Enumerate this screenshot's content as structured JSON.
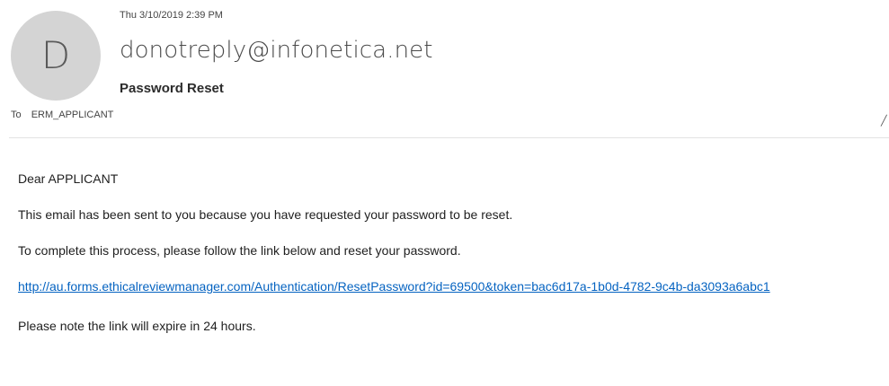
{
  "header": {
    "avatar_letter": "D",
    "sent_date": "Thu 3/10/2019 2:39 PM",
    "sender": "donotreply@infonetica.net",
    "subject": "Password Reset",
    "to_label": "To",
    "to_recipient": "ERM_APPLICANT",
    "expand_glyph": "╱"
  },
  "body": {
    "greeting": "Dear APPLICANT",
    "line1": "This email has been sent to you because you have requested your password to be reset.",
    "line2": "To complete this process, please follow the link below and reset your password.",
    "link": "http://au.forms.ethicalreviewmanager.com/Authentication/ResetPassword?id=69500&token=bac6d17a-1b0d-4782-9c4b-da3093a6abc1",
    "line3": "Please note the link will expire in 24 hours."
  },
  "colors": {
    "avatar_bg": "#d4d4d4",
    "link": "#0563c1"
  }
}
